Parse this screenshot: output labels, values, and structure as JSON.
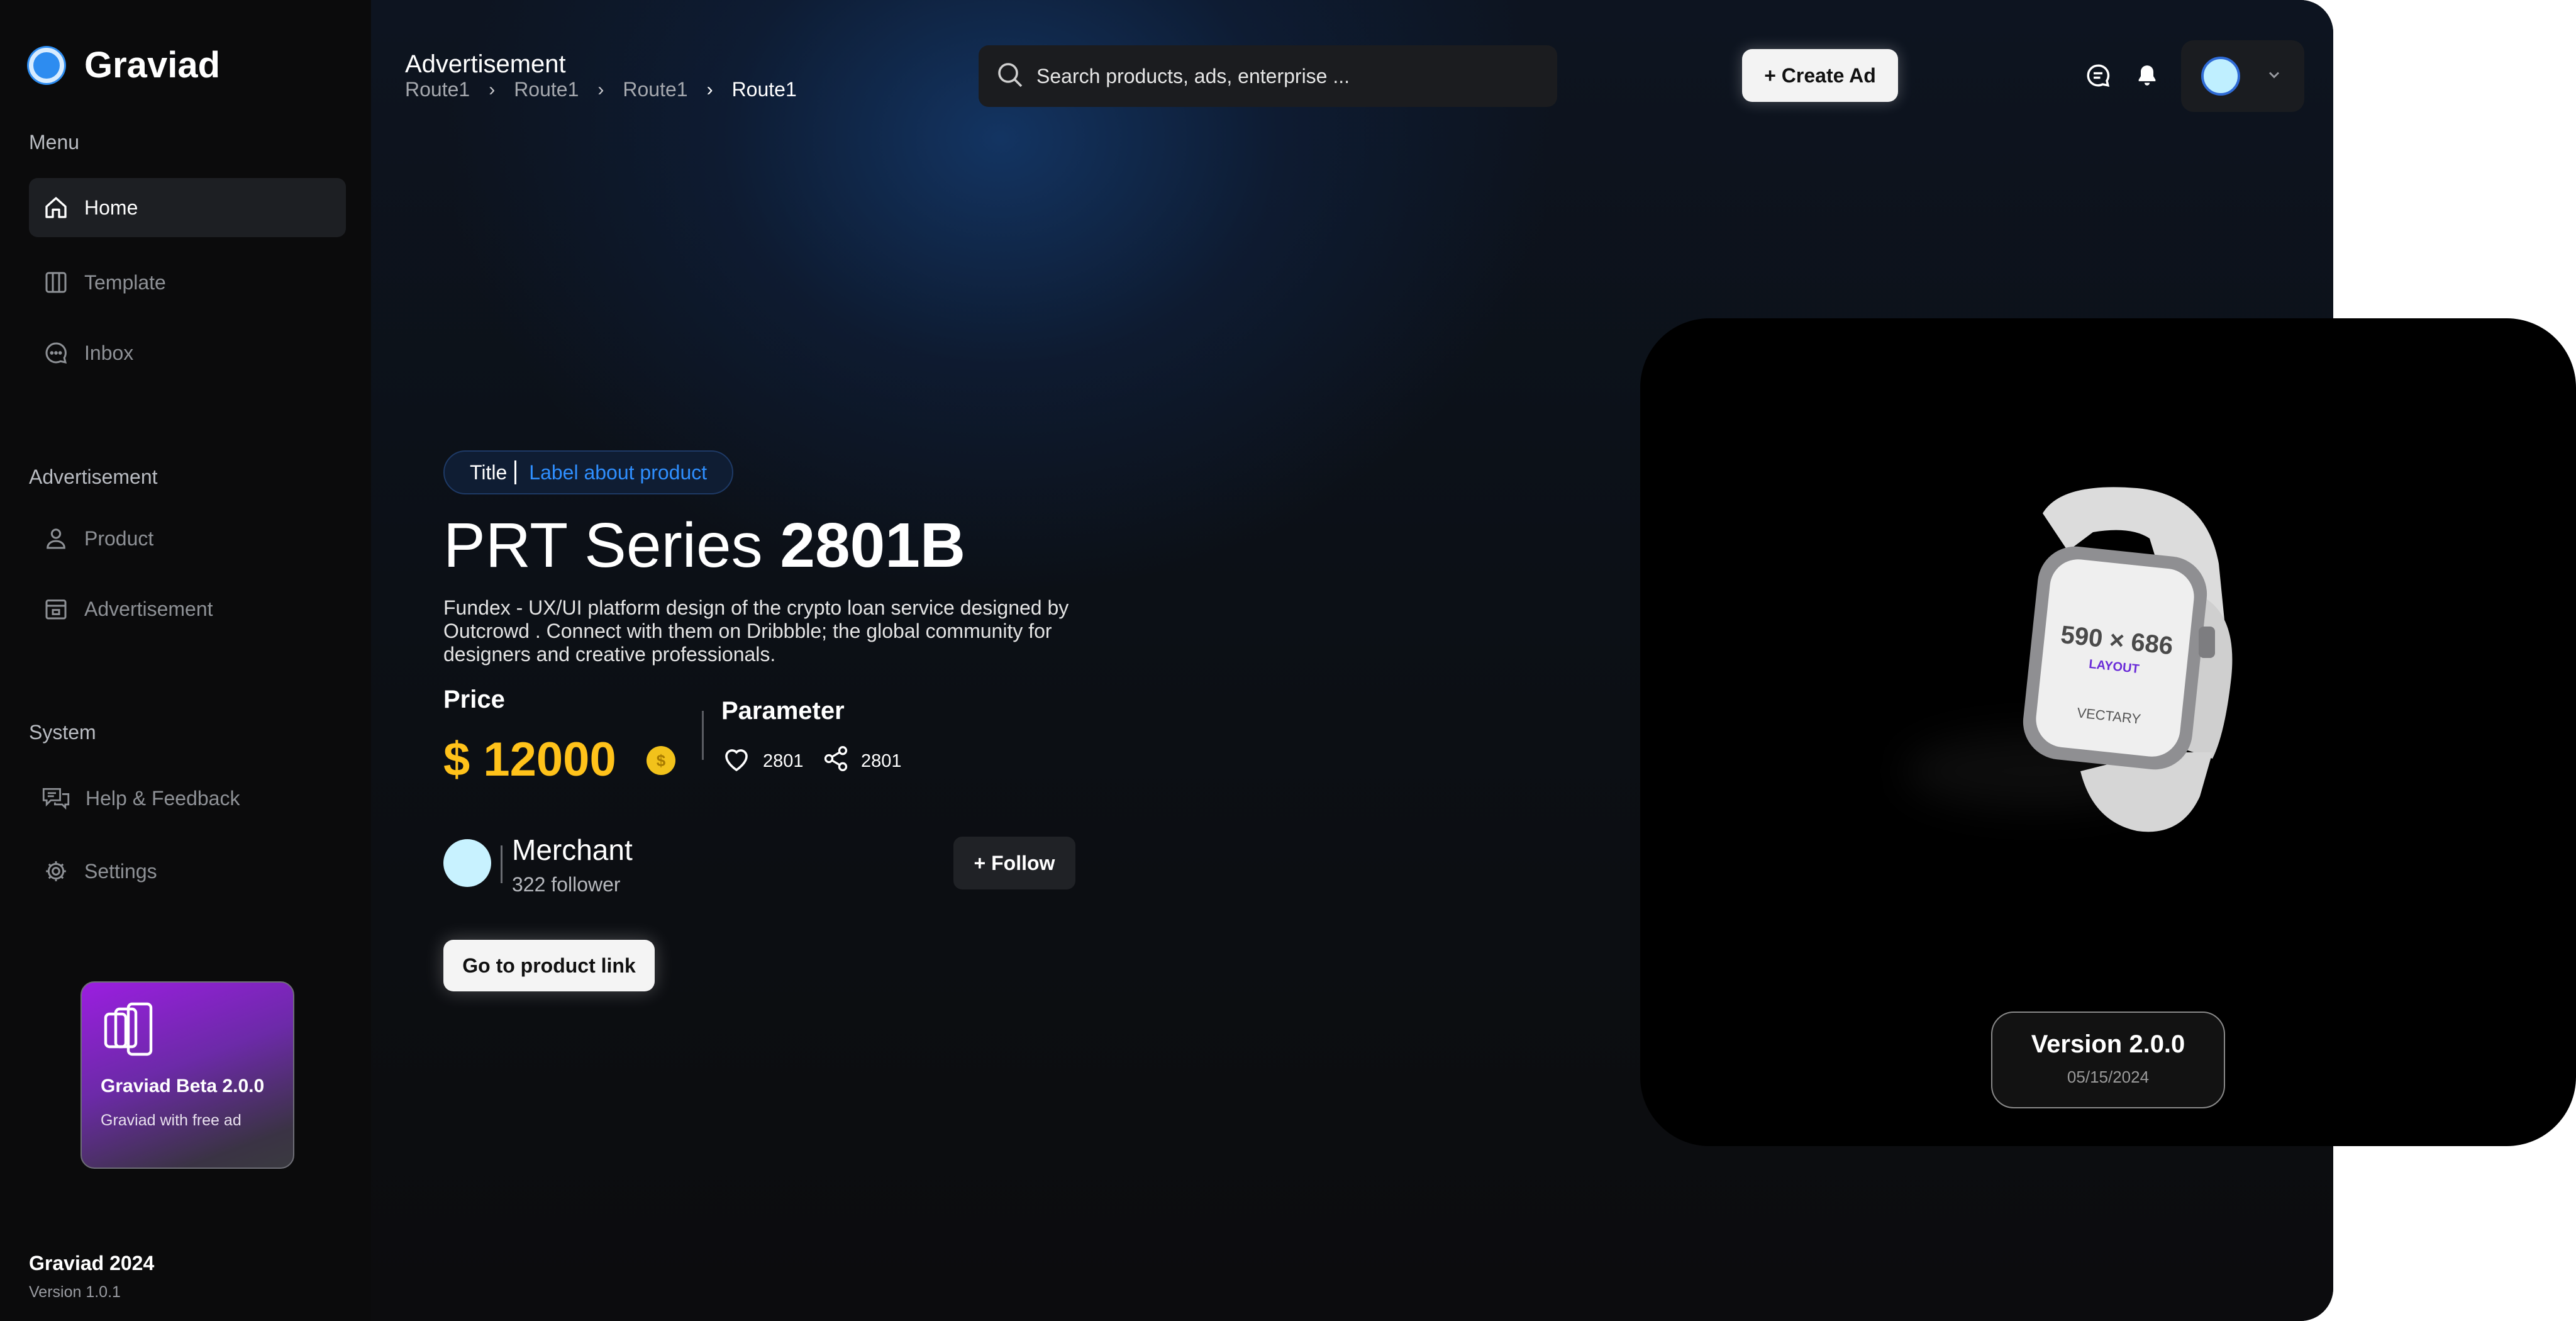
{
  "sidebar": {
    "brand": "Graviad",
    "menu_label": "Menu",
    "menu_items": [
      {
        "label": "Home",
        "icon": "home-icon",
        "active": true
      },
      {
        "label": "Template",
        "icon": "columns-icon"
      },
      {
        "label": "Inbox",
        "icon": "chat-bubble-icon"
      }
    ],
    "advert_label": "Advertisement",
    "advert_items": [
      {
        "label": "Product",
        "icon": "user-icon"
      },
      {
        "label": "Advertisement",
        "icon": "store-icon"
      }
    ],
    "system_label": "System",
    "system_items": [
      {
        "label": "Help & Feedback",
        "icon": "feedback-icon"
      },
      {
        "label": "Settings",
        "icon": "gear-icon"
      }
    ],
    "promo": {
      "title": "Graviad Beta 2.0.0",
      "subtitle": "Graviad with free ad"
    },
    "footer": {
      "title": "Graviad 2024",
      "version": "Version 1.0.1"
    }
  },
  "header": {
    "title": "Advertisement",
    "breadcrumbs": [
      "Route1",
      "Route1",
      "Route1",
      "Route1"
    ],
    "search_placeholder": "Search products, ads, enterprise ...",
    "create_label": "+ Create Ad"
  },
  "product": {
    "tag_title": "Title",
    "tag_label": "Label about product",
    "name": "PRT Series",
    "model": "2801B",
    "description": "Fundex - UX/UI platform design of the crypto loan service designed by Outcrowd . Connect with them on Dribbble; the global community for designers and creative professionals.",
    "price_label": "Price",
    "price": "$ 12000",
    "parameter_label": "Parameter",
    "likes": "2801",
    "shares": "2801"
  },
  "merchant": {
    "name": "Merchant",
    "followers": "322 follower",
    "follow_label": "+ Follow"
  },
  "go_link_label": "Go to product link",
  "preview": {
    "watch_text": "590 × 686",
    "watch_sub": "LAYOUT",
    "watch_brand": "VECTARY",
    "version": "Version 2.0.0",
    "date": "05/15/2024"
  },
  "colors": {
    "accent": "#2d8cf0",
    "price": "#ffc21a",
    "tag_label": "#2f8fff",
    "promo": "#9b1ee0"
  }
}
